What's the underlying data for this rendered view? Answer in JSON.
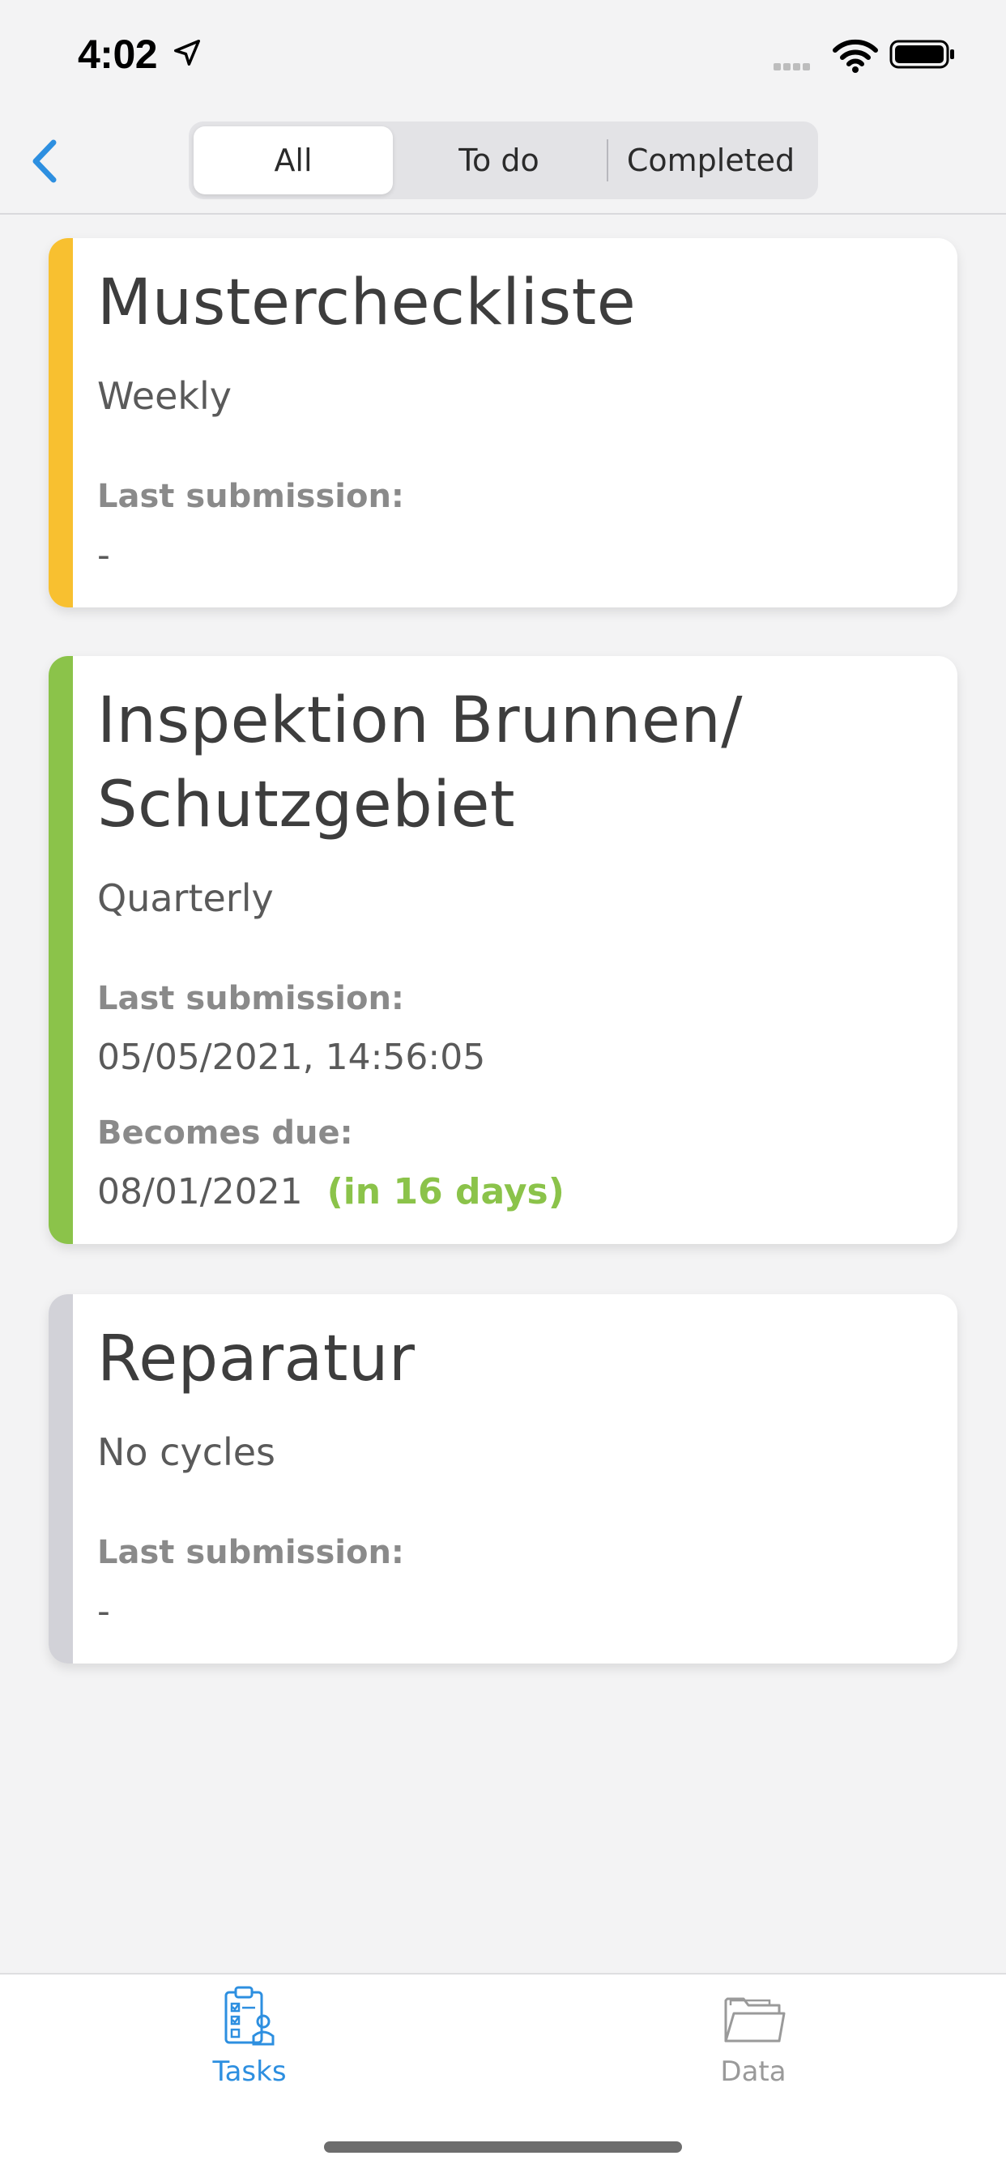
{
  "status_bar": {
    "time": "4:02"
  },
  "tabs_filter": {
    "all_label": "All",
    "todo_label": "To do",
    "completed_label": "Completed",
    "selected": "All"
  },
  "cards": [
    {
      "title": "Mustercheckliste",
      "cycle": "Weekly",
      "last_submission_label": "Last submission:",
      "last_submission_value": "-",
      "stripe_color": "#f8c030"
    },
    {
      "title_line1": "Inspektion Brunnen/",
      "title_line2": "Schutzgebiet",
      "cycle": "Quarterly",
      "last_submission_label": "Last submission:",
      "last_submission_value": "05/05/2021, 14:56:05",
      "becomes_due_label": "Becomes due:",
      "becomes_due_value": "08/01/2021",
      "becomes_due_note": "(in 16 days)",
      "stripe_color": "#8bc34a"
    },
    {
      "title": "Reparatur",
      "cycle": "No cycles",
      "last_submission_label": "Last submission:",
      "last_submission_value": "-",
      "stripe_color": "#d2d2d8"
    }
  ],
  "tab_bar": {
    "tasks_label": "Tasks",
    "data_label": "Data",
    "active": "Tasks",
    "active_color": "#2d8fe0",
    "inactive_color": "#9a9a9a"
  },
  "icons": {
    "back": "chevron-left-icon",
    "location": "location-arrow-icon",
    "wifi": "wifi-icon",
    "battery": "battery-icon",
    "tasks": "clipboard-checklist-icon",
    "data": "folder-icon"
  }
}
